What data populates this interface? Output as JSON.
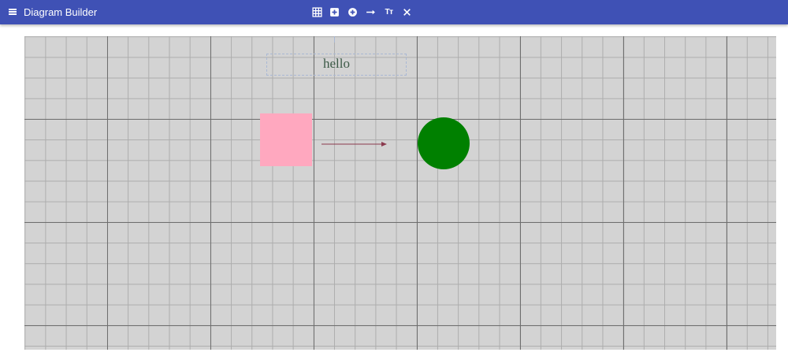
{
  "app": {
    "title": "Diagram Builder"
  },
  "toolbar": {
    "menu_icon": "hamburger-menu-icon",
    "tools": [
      {
        "name": "grid-tool",
        "icon": "grid-icon"
      },
      {
        "name": "add-rectangle-tool",
        "icon": "plus-square-icon"
      },
      {
        "name": "add-circle-tool",
        "icon": "plus-circle-icon"
      },
      {
        "name": "add-arrow-tool",
        "icon": "arrow-right-icon"
      },
      {
        "name": "add-text-tool",
        "icon": "text-icon",
        "label": "Tт"
      },
      {
        "name": "delete-tool",
        "icon": "close-icon"
      }
    ]
  },
  "canvas": {
    "background": "#d3d3d3",
    "grid_lines": "#6e6e6e",
    "shapes": [
      {
        "type": "text",
        "text": "hello",
        "color": "#3d5a47",
        "selected": true
      },
      {
        "type": "rectangle",
        "fill": "#ffa8bf"
      },
      {
        "type": "arrow",
        "color": "#8b3a4e"
      },
      {
        "type": "circle",
        "fill": "#008000"
      }
    ]
  }
}
